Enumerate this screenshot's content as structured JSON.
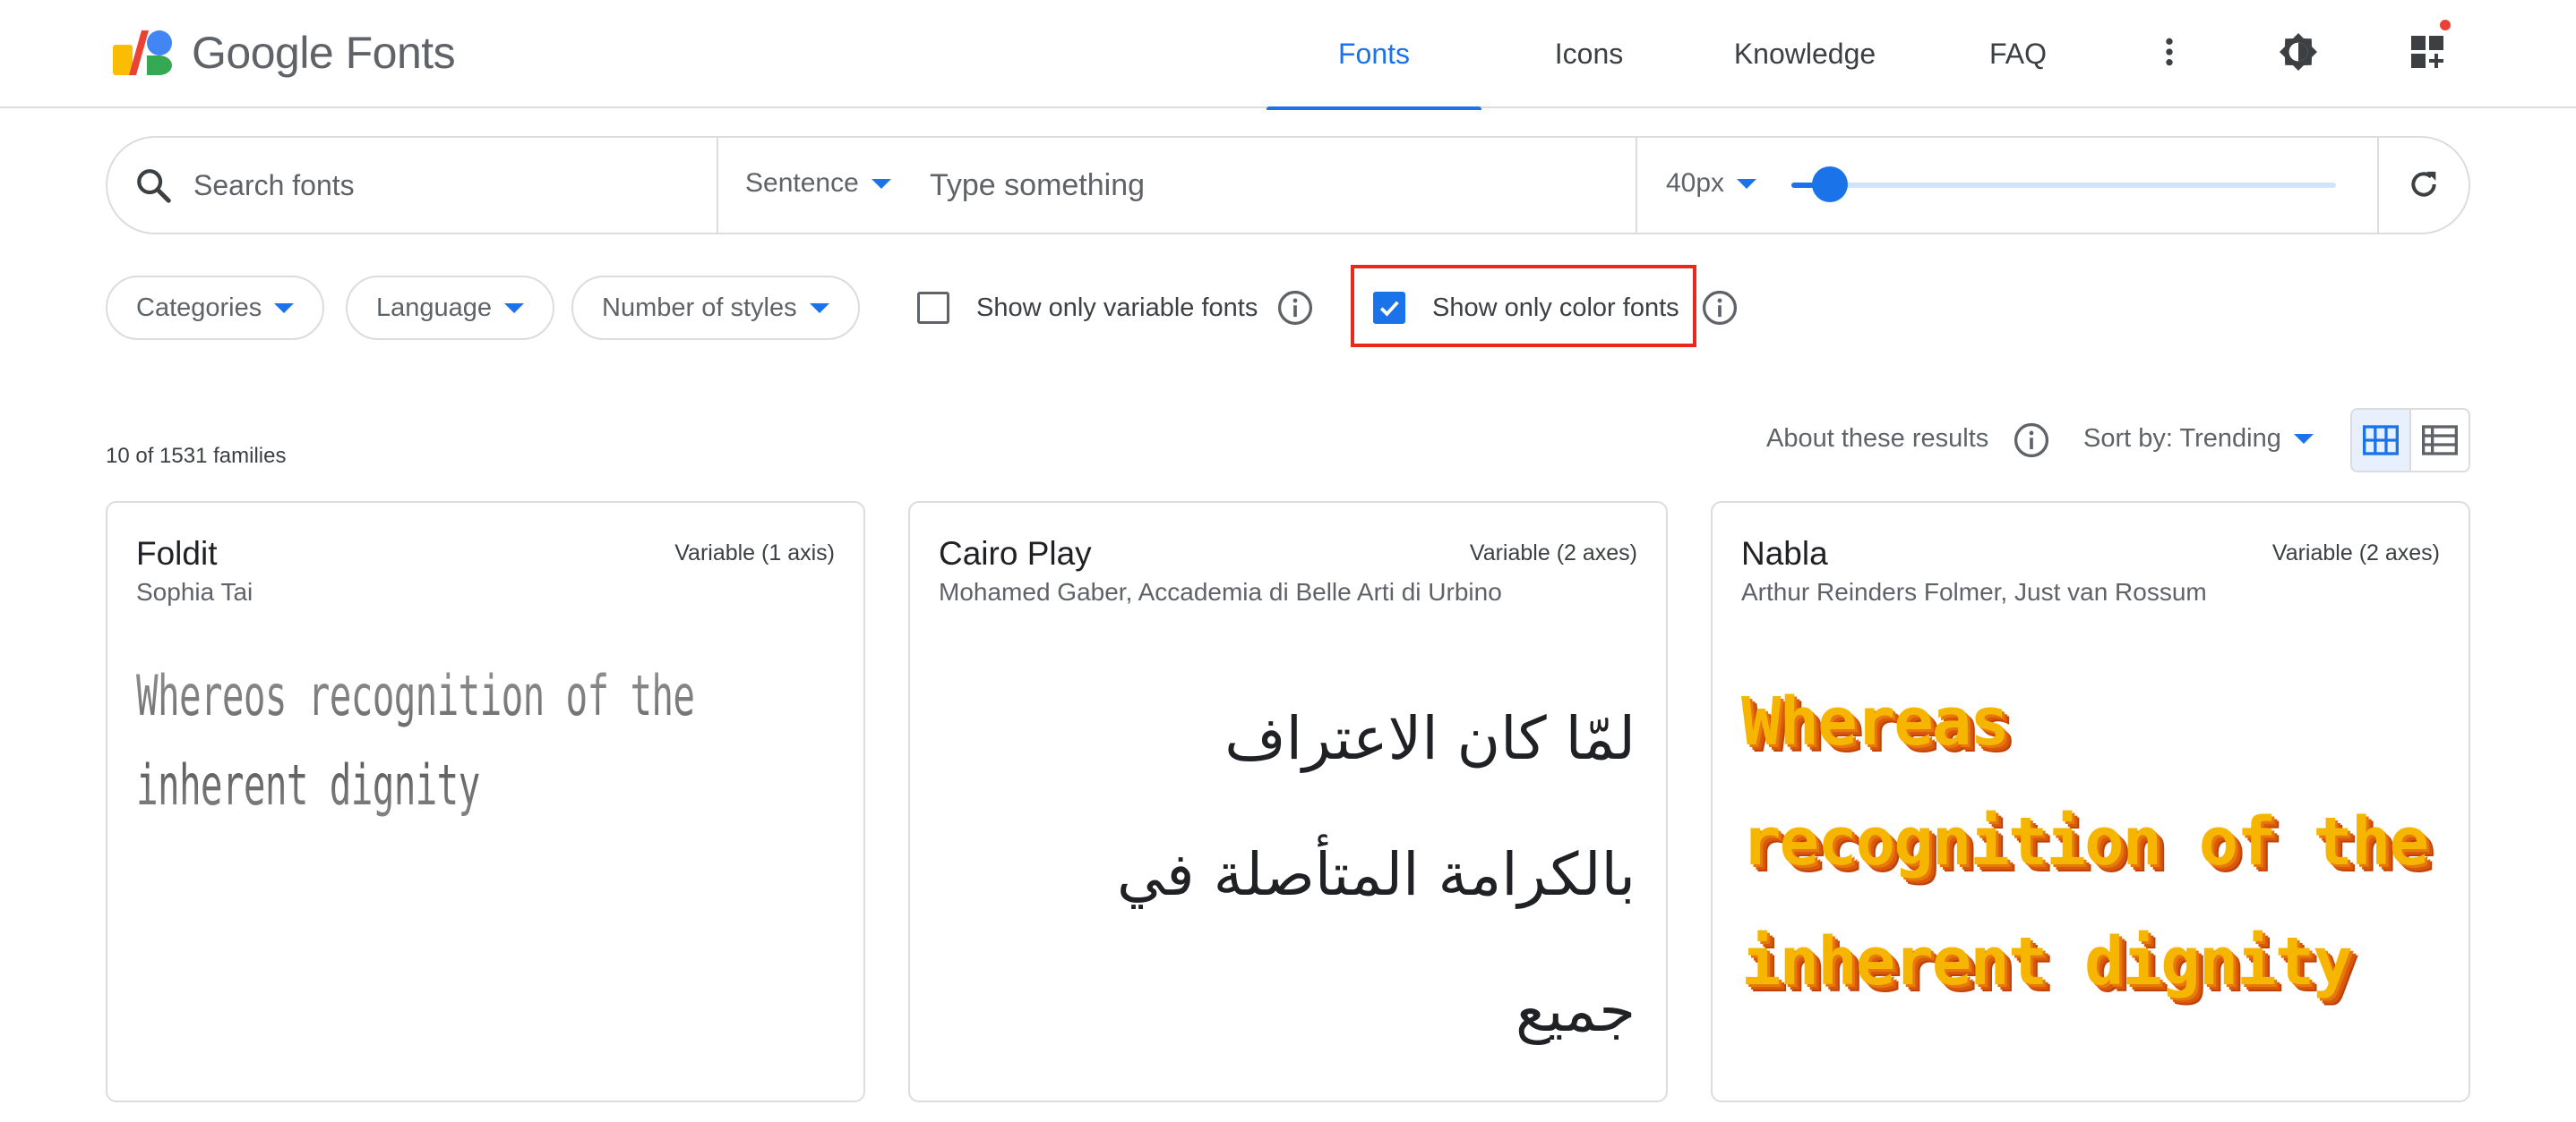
{
  "header": {
    "logo_text": "Google Fonts",
    "nav": [
      {
        "label": "Fonts",
        "active": true
      },
      {
        "label": "Icons",
        "active": false
      },
      {
        "label": "Knowledge",
        "active": false
      },
      {
        "label": "FAQ",
        "active": false
      }
    ],
    "icons": [
      "more-vert-icon",
      "theme-toggle-icon",
      "add-widget-icon"
    ],
    "notification_dot_color": "#ea4335"
  },
  "search": {
    "placeholder": "Search fonts",
    "preview_mode": "Sentence",
    "preview_placeholder": "Type something",
    "size_label": "40px",
    "size_slider_fraction": 0.07
  },
  "filters": {
    "chips": [
      "Categories",
      "Language",
      "Number of styles"
    ],
    "variable_label": "Show only variable fonts",
    "variable_checked": false,
    "color_label": "Show only color fonts",
    "color_checked": true
  },
  "results": {
    "count_text": "10 of 1531 families",
    "about_label": "About these results",
    "sort_label": "Sort by: Trending",
    "view_mode": "grid"
  },
  "cards": [
    {
      "name": "Foldit",
      "axis": "Variable (1 axis)",
      "author": "Sophia Tai",
      "sample": "Whereos recognition of the inherent dignity"
    },
    {
      "name": "Cairo Play",
      "axis": "Variable (2 axes)",
      "author": "Mohamed Gaber, Accademia di Belle Arti di Urbino",
      "sample_lines": [
        "لمّا كان الاعتراف",
        "بالكرامة المتأصلة في",
        "جميع"
      ]
    },
    {
      "name": "Nabla",
      "axis": "Variable (2 axes)",
      "author": "Arthur Reinders Folmer, Just van Rossum",
      "sample": "Whereas recognition of the inherent dignity"
    }
  ],
  "colors": {
    "accent": "#1a73e8",
    "highlight": "#e8291c",
    "border": "#dadce0",
    "nabla_face": "#f6b600",
    "nabla_side": "#e8780c"
  }
}
